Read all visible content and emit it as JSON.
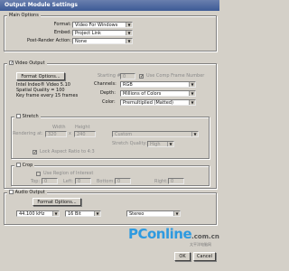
{
  "window": {
    "title": "Output Module Settings"
  },
  "main_options": {
    "title": "Main Options",
    "format_label": "Format:",
    "format_value": "Video For Windows",
    "embed_label": "Embed:",
    "embed_value": "Project Link",
    "post_render_label": "Post-Render Action:",
    "post_render_value": "None"
  },
  "video_output": {
    "title": "Video Output",
    "checked": true,
    "format_options_button": "Format Options...",
    "info_lines": [
      "Intel Indeo® Video 5.10",
      "Spatial Quality = 100",
      "Key frame every 15 frames"
    ],
    "starting_label": "Starting #:",
    "starting_value": "0",
    "use_comp_frame_label": "Use Comp Frame Number",
    "channels_label": "Channels:",
    "channels_value": "RGB",
    "depth_label": "Depth:",
    "depth_value": "Millions of Colors",
    "color_label": "Color:",
    "color_value": "Premultiplied (Matted)"
  },
  "stretch": {
    "title": "Stretch",
    "width_label": "Width",
    "height_label": "Height",
    "rendering_at_label": "Rendering at:",
    "rendering_at_value": "320",
    "rendering_at_height": "240",
    "stretch_to_label": "Stretch to:",
    "stretch_to_value": "320",
    "stretch_to_height": "240",
    "stretch_percent_label": "Stretch %:",
    "preset_value": "Custom",
    "quality_label": "Stretch Quality:",
    "quality_value": "High",
    "lock_aspect_label": "Lock Aspect Ratio to 4:3"
  },
  "crop": {
    "title": "Crop",
    "use_roi_label": "Use Region of Interest",
    "top_label": "Top:",
    "top_value": "0",
    "left_label": "Left:",
    "left_value": "0",
    "bottom_label": "Bottom:",
    "bottom_value": "0",
    "right_label": "Right:",
    "right_value": "0"
  },
  "audio_output": {
    "title": "Audio Output",
    "format_options_button": "Format Options...",
    "rate_value": "44.100 kHz",
    "bits_value": "16 Bit",
    "channels_value": "Stereo"
  },
  "buttons": {
    "ok": "OK",
    "cancel": "Cancel"
  },
  "watermark": {
    "brand": "PConline",
    "domain": ".com.cn",
    "slogan": "太平洋电脑网"
  }
}
